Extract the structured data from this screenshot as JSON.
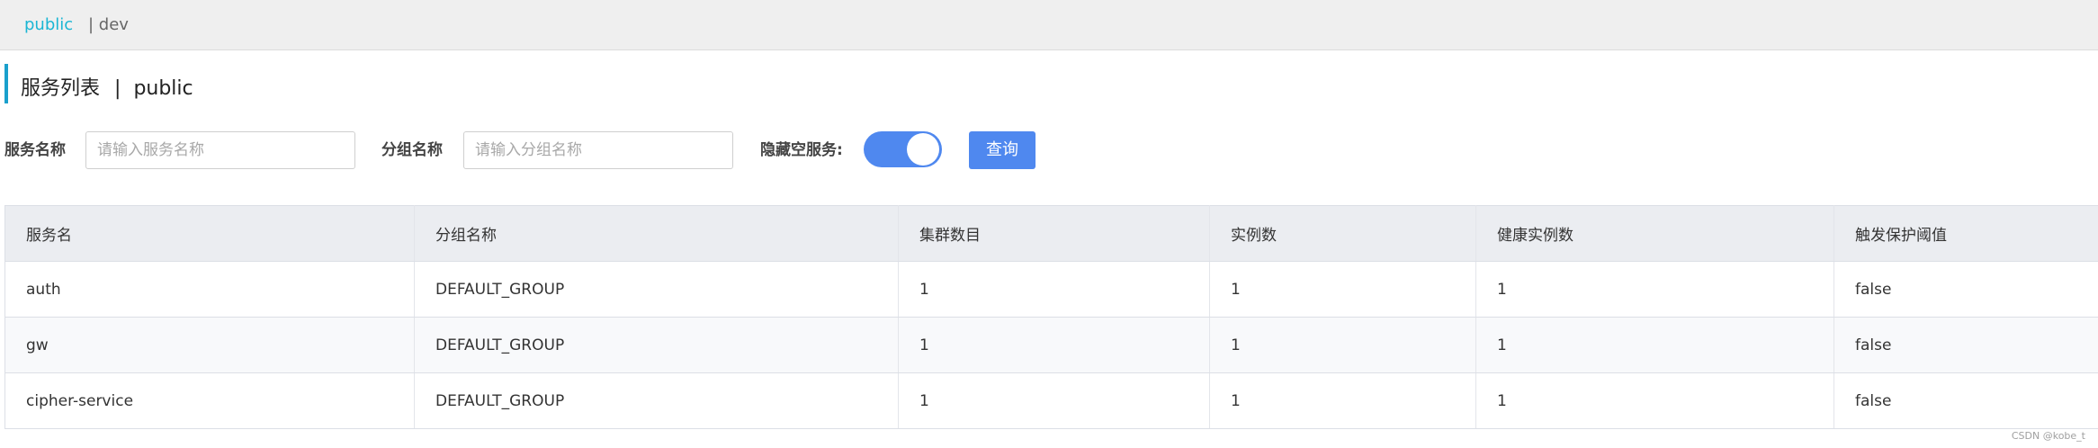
{
  "namespace_bar": {
    "items": [
      {
        "label": "public",
        "active": true
      },
      {
        "label": "| dev",
        "active": false
      }
    ],
    "active_color": "#1ab6d4"
  },
  "page_title": {
    "main": "服务列表",
    "separator": "|",
    "namespace": "public"
  },
  "filters": {
    "service_name_label": "服务名称",
    "service_name_placeholder": "请输入服务名称",
    "service_name_value": "",
    "group_name_label": "分组名称",
    "group_name_placeholder": "请输入分组名称",
    "group_name_value": "",
    "hide_empty_label": "隐藏空服务:",
    "hide_empty_enabled": true,
    "query_button": "查询"
  },
  "table": {
    "columns": [
      "服务名",
      "分组名称",
      "集群数目",
      "实例数",
      "健康实例数",
      "触发保护阈值"
    ],
    "rows": [
      [
        "auth",
        "DEFAULT_GROUP",
        "1",
        "1",
        "1",
        "false"
      ],
      [
        "gw",
        "DEFAULT_GROUP",
        "1",
        "1",
        "1",
        "false"
      ],
      [
        "cipher-service",
        "DEFAULT_GROUP",
        "1",
        "1",
        "1",
        "false"
      ]
    ]
  },
  "watermark": "CSDN @kobe_t",
  "colors": {
    "accent": "#4f88ef",
    "title_bar": "#1aa0cc"
  }
}
